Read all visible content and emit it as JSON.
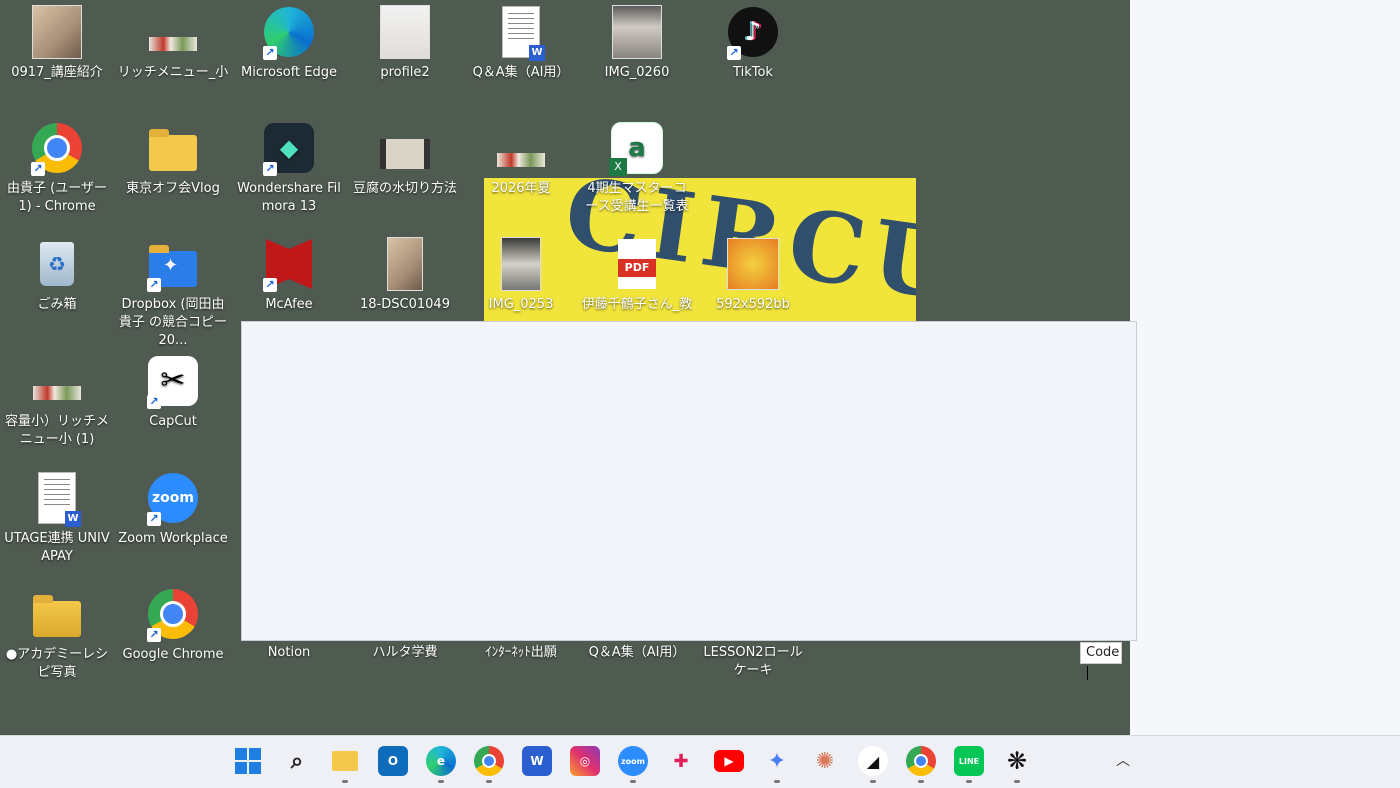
{
  "desktop": {
    "icons": [
      {
        "label": "0917_講座紹介",
        "icon": "photo-thumbnail"
      },
      {
        "label": "リッチメニュー_小",
        "icon": "image-strip"
      },
      {
        "label": "Microsoft Edge",
        "icon": "edge-icon"
      },
      {
        "label": "profile2",
        "icon": "photo-thumbnail"
      },
      {
        "label": "Q＆A集（AI用）",
        "icon": "word-doc"
      },
      {
        "label": "IMG_0260",
        "icon": "photo-thumbnail"
      },
      {
        "label": "TikTok",
        "icon": "tiktok-icon"
      },
      {
        "label": "由貴子 (ユーザー 1) - Chrome",
        "icon": "chrome-icon"
      },
      {
        "label": "東京オフ会Vlog",
        "icon": "folder-icon"
      },
      {
        "label": "Wondershare Filmora 13",
        "icon": "filmora-icon"
      },
      {
        "label": "豆腐の水切り方法",
        "icon": "video-thumbnail"
      },
      {
        "label": "2026年夏",
        "icon": "image-strip"
      },
      {
        "label": "4期生マスターコース受講生一覧表",
        "icon": "excel-icon"
      },
      {
        "label": "ごみ箱",
        "icon": "recycle-bin-icon"
      },
      {
        "label": "Dropbox (岡田由貴子 の競合コピー 20...",
        "icon": "dropbox-icon"
      },
      {
        "label": "McAfee",
        "icon": "mcafee-icon"
      },
      {
        "label": "18-DSC01049",
        "icon": "photo-thumbnail"
      },
      {
        "label": "IMG_0253",
        "icon": "photo-thumbnail"
      },
      {
        "label": "伊藤千鶴子さん_教",
        "icon": "pdf-icon"
      },
      {
        "label": "592x592bb",
        "icon": "image-thumbnail"
      },
      {
        "label": "容量小）リッチメニュー小 (1)",
        "icon": "image-strip"
      },
      {
        "label": "CapCut",
        "icon": "capcut-icon"
      },
      {
        "label": "UTAGE連携 UNIVAPAY",
        "icon": "word-doc"
      },
      {
        "label": "Zoom Workplace",
        "icon": "zoom-icon"
      },
      {
        "label": "●アカデミーレシピ写真",
        "icon": "folder-icon"
      },
      {
        "label": "Google Chrome",
        "icon": "chrome-icon"
      },
      {
        "label": "Notion",
        "icon": "notion-icon"
      },
      {
        "label": "ハルタ学費",
        "icon": "file-icon"
      },
      {
        "label": "ｲﾝﾀｰﾈｯﾄ出願",
        "icon": "file-icon"
      },
      {
        "label": "Q＆A集（AI用）",
        "icon": "file-icon"
      },
      {
        "label": "LESSON2ロールケーキ",
        "icon": "file-icon"
      }
    ],
    "circus_text": "CIRCUS",
    "code_input": {
      "value": "Code"
    }
  },
  "taskbar": {
    "items": [
      {
        "name": "start-icon",
        "glyph": "⊞"
      },
      {
        "name": "search-icon",
        "glyph": "⌕"
      },
      {
        "name": "file-explorer-icon",
        "glyph": ""
      },
      {
        "name": "outlook-icon",
        "glyph": "O"
      },
      {
        "name": "edge-icon",
        "glyph": "e"
      },
      {
        "name": "chrome-icon",
        "glyph": ""
      },
      {
        "name": "word-icon",
        "glyph": "W"
      },
      {
        "name": "instagram-icon",
        "glyph": "◎"
      },
      {
        "name": "zoom-icon",
        "glyph": "zoom"
      },
      {
        "name": "slack-icon",
        "glyph": "✚"
      },
      {
        "name": "youtube-icon",
        "glyph": "▶"
      },
      {
        "name": "gemini-icon",
        "glyph": "✦"
      },
      {
        "name": "claude-icon",
        "glyph": "✺"
      },
      {
        "name": "app-icon",
        "glyph": "◢"
      },
      {
        "name": "chrome-icon-2",
        "glyph": ""
      },
      {
        "name": "line-icon",
        "glyph": "LINE"
      },
      {
        "name": "chatgpt-icon",
        "glyph": "❋"
      }
    ]
  }
}
